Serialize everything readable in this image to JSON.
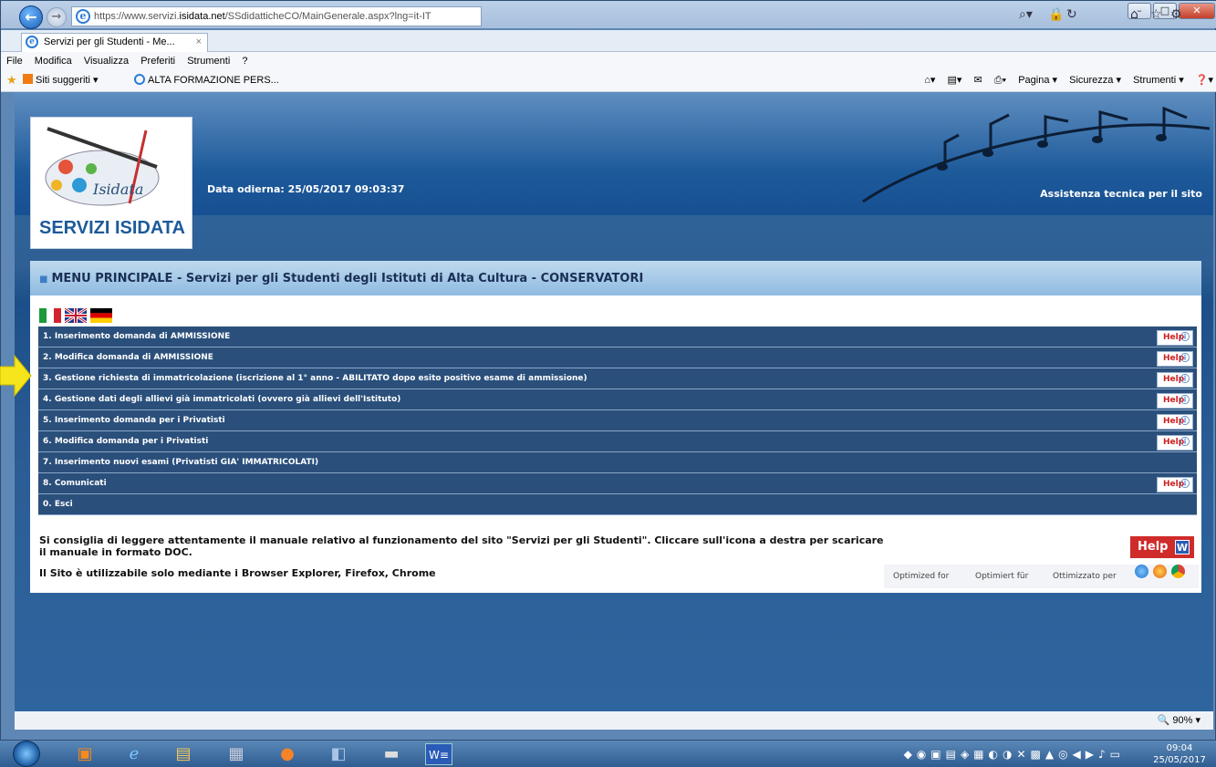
{
  "browser": {
    "url_prefix": "https://www.servizi.",
    "url_host": "isidata.net",
    "url_path": "/SSdidatticheCO/MainGenerale.aspx?lng=it-IT",
    "tab_title": "Servizi per gli Studenti - Me...",
    "tab_close": "×",
    "menu": [
      "File",
      "Modifica",
      "Visualizza",
      "Preferiti",
      "Strumenti",
      "?"
    ],
    "favorites": [
      {
        "label": "Siti suggeriti ▾"
      },
      {
        "label": "ALTA FORMAZIONE PERS..."
      }
    ],
    "command_bar": [
      "Pagina ▾",
      "Sicurezza ▾",
      "Strumenti ▾"
    ],
    "zoom": "90%"
  },
  "header": {
    "logo_title": "SERVIZI ISIDATA",
    "logo_brand": "Isidata",
    "date_text": "Data odierna: 25/05/2017 09:03:37",
    "assist_link": "Assistenza tecnica per il sito"
  },
  "panel": {
    "title": "MENU PRINCIPALE - Servizi per gli Studenti degli Istituti di Alta Cultura - CONSERVATORI",
    "help_label": "Help",
    "items": [
      {
        "label": "1. Inserimento domanda di AMMISSIONE",
        "help": true
      },
      {
        "label": "2. Modifica domanda di AMMISSIONE",
        "help": true
      },
      {
        "label": "3. Gestione richiesta di immatricolazione (iscrizione al 1° anno - ABILITATO dopo esito positivo esame di ammissione)",
        "help": true
      },
      {
        "label": "4. Gestione dati degli allievi già immatricolati (ovvero già allievi dell'Istituto)",
        "help": true
      },
      {
        "label": "5. Inserimento domanda per i Privatisti",
        "help": true
      },
      {
        "label": "6. Modifica domanda per i Privatisti",
        "help": true
      },
      {
        "label": "7. Inserimento nuovi esami (Privatisti GIA' IMMATRICOLATI)",
        "help": false
      },
      {
        "label": "8. Comunicati",
        "help": true
      },
      {
        "label": "0. Esci",
        "help": false
      }
    ],
    "advice": "Si consiglia di leggere attentamente il manuale relativo al funzionamento del sito \"Servizi per gli Studenti\". Cliccare sull'icona a destra per scaricare il manuale in formato DOC.",
    "browser_note": "Il Sito è utilizzabile solo mediante i Browser Explorer, Firefox, Chrome",
    "big_help": "Help",
    "optimized": [
      "Optimized for",
      "Optimiert für",
      "Ottimizzato per"
    ]
  },
  "taskbar": {
    "time": "09:04",
    "date": "25/05/2017"
  },
  "colors": {
    "menu_row": "#2a4f7b",
    "help_text": "#d01f1f",
    "header_blue": "#1d5a9a",
    "arrow": "#f5e51a"
  }
}
